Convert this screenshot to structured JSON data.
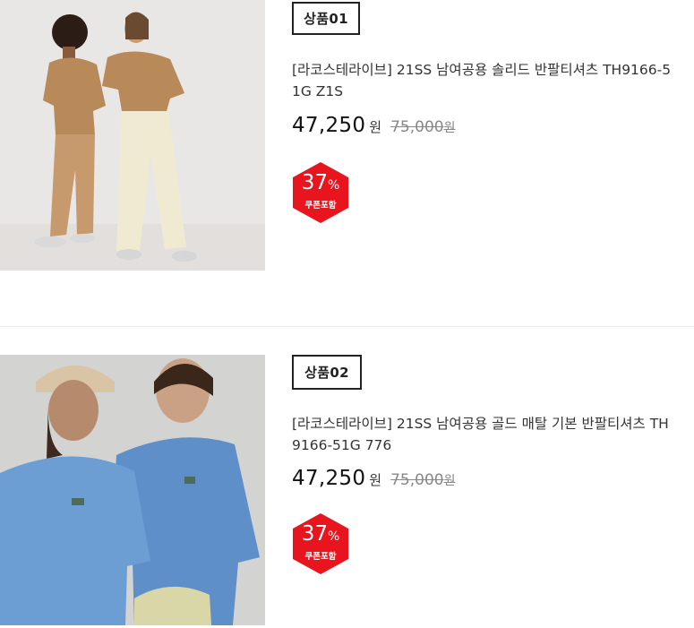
{
  "products": [
    {
      "tag": "상품01",
      "title": "[라코스테라이브] 21SS 남여공용 솔리드 반팔티셔츠 TH9166-51G Z1S",
      "sale_price": "47,250",
      "sale_unit": "원",
      "original_price": "75,000",
      "original_unit": "원",
      "discount": "37",
      "discount_unit": "%",
      "discount_note": "쿠폰포함",
      "image_desc": "two models in beige t-shirts"
    },
    {
      "tag": "상품02",
      "title": "[라코스테라이브] 21SS 남여공용 골드 매탈 기본 반팔티셔츠 TH9166-51G 776",
      "sale_price": "47,250",
      "sale_unit": "원",
      "original_price": "75,000",
      "original_unit": "원",
      "discount": "37",
      "discount_unit": "%",
      "discount_note": "쿠폰포함",
      "image_desc": "two models in blue t-shirts"
    }
  ],
  "colors": {
    "badge_red": "#e8141e",
    "text": "#222222",
    "muted": "#888888"
  }
}
